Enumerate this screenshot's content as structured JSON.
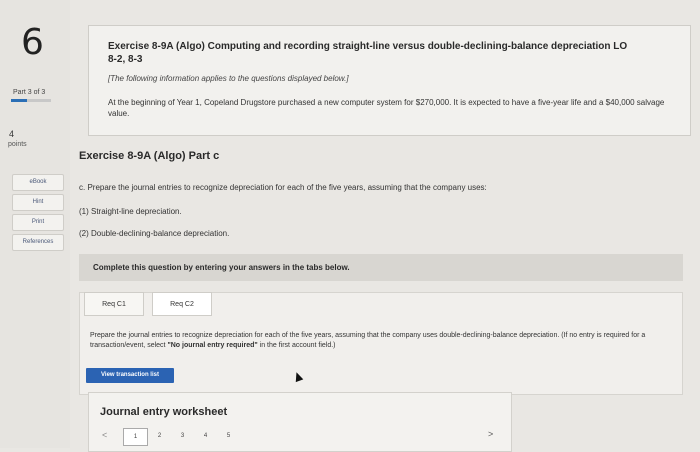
{
  "sidebar": {
    "question_number": "6",
    "part_label": "Part 3 of 3",
    "part_progress": 0.4,
    "points_value": "4",
    "points_label": "points",
    "buttons": [
      "eBook",
      "Hint",
      "Print",
      "References"
    ]
  },
  "header": {
    "title": "Exercise 8-9A (Algo) Computing and recording straight-line versus double-declining-balance depreciation LO 8-2, 8-3",
    "note": "[The following information applies to the questions displayed below.]",
    "body": "At the beginning of Year 1, Copeland Drugstore purchased a new computer system for $270,000. It is expected to have a five-year life and a $40,000 salvage value."
  },
  "part": {
    "title": "Exercise 8-9A (Algo) Part c",
    "instruction": "c. Prepare the journal entries to recognize depreciation for each of the five years, assuming that the company uses:",
    "option1": "(1) Straight-line depreciation.",
    "option2": "(2) Double-declining-balance depreciation."
  },
  "complete_bar": "Complete this question by entering your answers in the tabs below.",
  "tabs": [
    "Req C1",
    "Req C2"
  ],
  "panel": {
    "text_main": "Prepare the journal entries to recognize depreciation for each of the five years, assuming that the company uses double-declining-balance depreciation. (If no entry is required for a transaction/event, select ",
    "text_quote": "\"No journal entry required\"",
    "text_end": " in the first account field.)",
    "button_label": "View transaction list"
  },
  "worksheet": {
    "title": "Journal entry worksheet",
    "prev": "<",
    "next": ">",
    "pages": [
      "1",
      "2",
      "3",
      "4",
      "5"
    ],
    "active_page": "1"
  },
  "colors": {
    "accent": "#2b63b3",
    "progress": "#2b6fb6"
  }
}
